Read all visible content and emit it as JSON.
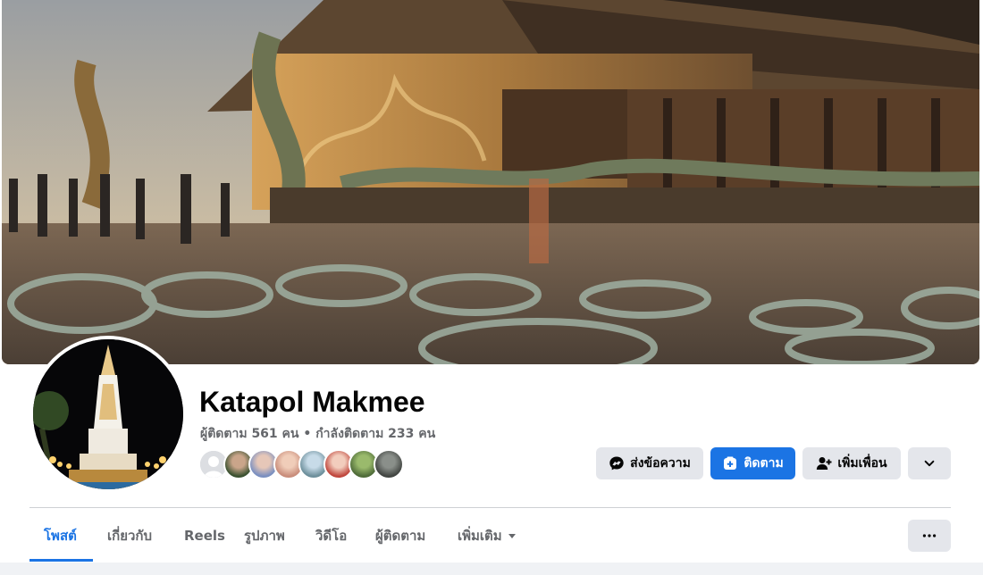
{
  "profile": {
    "name": "Katapol Makmee",
    "followers_text": "ผู้ติดตาม 561 คน",
    "separator": " • ",
    "following_text": "กำลังติดตาม 233 คน"
  },
  "actions": {
    "message_label": "ส่งข้อความ",
    "follow_label": "ติดตาม",
    "add_friend_label": "เพิ่มเพื่อน",
    "more_icon": "chevron-down-icon"
  },
  "tabs": [
    {
      "label": "โพสต์",
      "active": true
    },
    {
      "label": "เกี่ยวกับ"
    },
    {
      "label": "Reels"
    },
    {
      "label": "รูปภาพ"
    },
    {
      "label": "วิดีโอ"
    },
    {
      "label": "ผู้ติดตาม"
    },
    {
      "label": "เพิ่มเติม"
    }
  ],
  "colors": {
    "accent": "#1b74e4",
    "button_gray": "#e4e6eb",
    "secondary_text": "#65676b"
  }
}
